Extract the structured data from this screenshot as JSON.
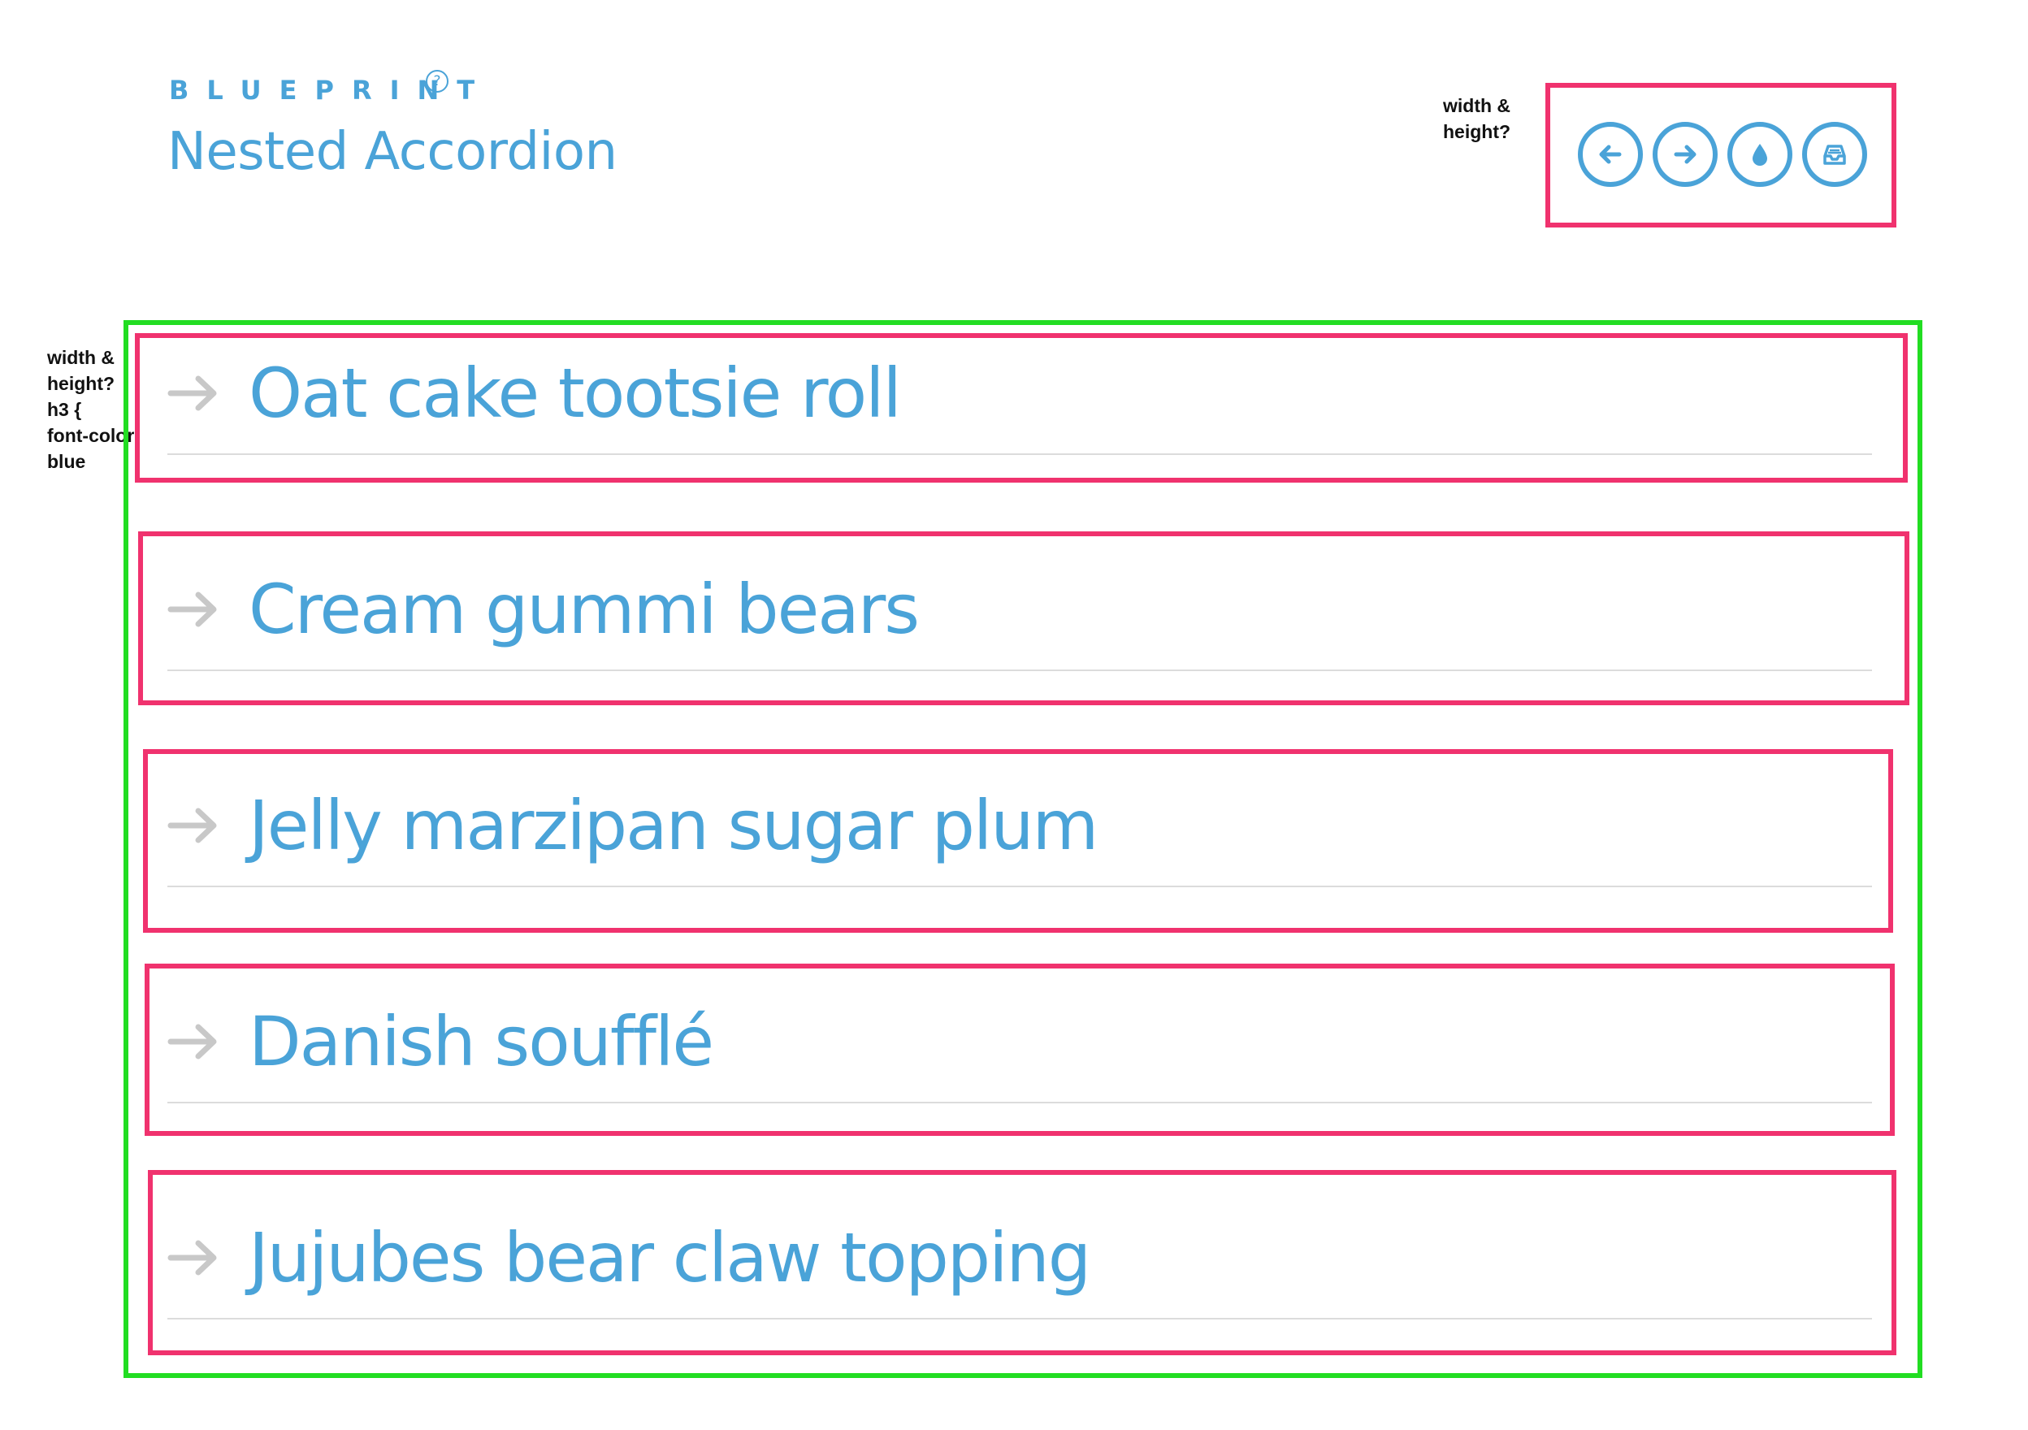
{
  "header": {
    "brand": "BLUEPRINT",
    "brand_help": "?",
    "title": "Nested Accordion"
  },
  "annotations": {
    "toolbar_note": "width &\nheight?",
    "accordion_note": "width &\nheight?\nh3 {\nfont-color:\nblue"
  },
  "toolbar": {
    "buttons": [
      {
        "icon": "arrow-left-icon"
      },
      {
        "icon": "arrow-right-icon"
      },
      {
        "icon": "droplet-icon"
      },
      {
        "icon": "inbox-icon"
      }
    ]
  },
  "accordion": {
    "items": [
      {
        "label": "Oat cake tootsie roll"
      },
      {
        "label": "Cream gummi bears"
      },
      {
        "label": "Jelly marzipan sugar plum"
      },
      {
        "label": "Danish soufflé"
      },
      {
        "label": "Jujubes bear claw topping"
      }
    ]
  },
  "colors": {
    "accent": "#4aa3d8",
    "annotation_box": "#f0326e",
    "container_box": "#22dd22",
    "arrow": "#c8c8c8",
    "divider": "#dcdcdc"
  }
}
